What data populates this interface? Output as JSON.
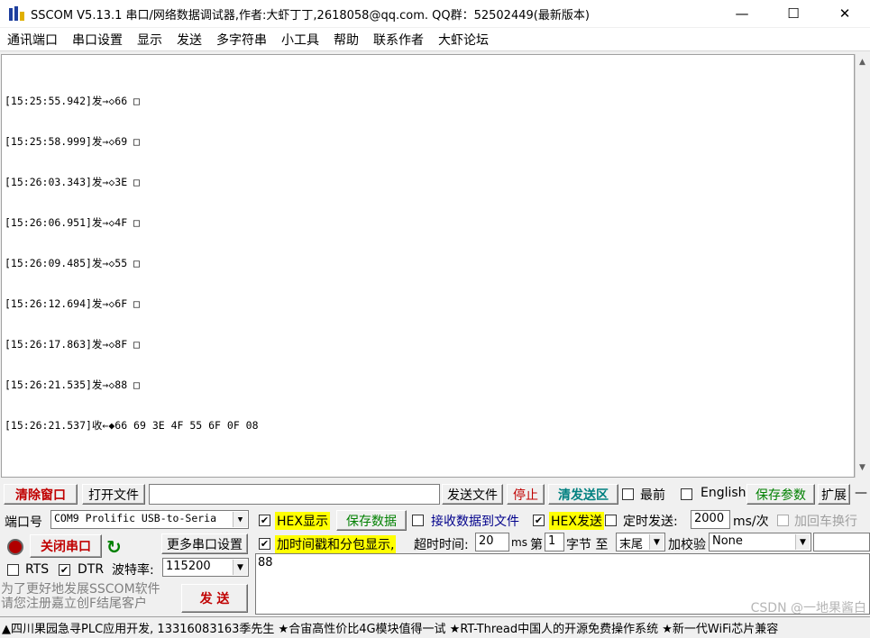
{
  "window": {
    "title": "SSCOM V5.13.1 串口/网络数据调试器,作者:大虾丁丁,2618058@qq.com. QQ群：52502449(最新版本)",
    "minimize": "—",
    "maximize": "☐",
    "close": "✕"
  },
  "menu": [
    "通讯端口",
    "串口设置",
    "显示",
    "发送",
    "多字符串",
    "小工具",
    "帮助",
    "联系作者",
    "大虾论坛"
  ],
  "log": [
    "[15:25:55.942]发→◇66 □",
    "[15:25:58.999]发→◇69 □",
    "[15:26:03.343]发→◇3E □",
    "[15:26:06.951]发→◇4F □",
    "[15:26:09.485]发→◇55 □",
    "[15:26:12.694]发→◇6F □",
    "[15:26:17.863]发→◇8F □",
    "[15:26:21.535]发→◇88 □",
    "[15:26:21.537]收←◆66 69 3E 4F 55 6F 0F 08"
  ],
  "toolbar": {
    "clear_window": "清除窗口",
    "open_file": "打开文件",
    "file_path": "",
    "send_file": "发送文件",
    "stop": "停止",
    "clear_send": "清发送区",
    "top_most": "最前",
    "english": "English",
    "save_params": "保存参数",
    "expand": "扩展",
    "dash": "—"
  },
  "port": {
    "label": "端口号",
    "value": "COM9 Prolific USB-to-Seria",
    "close_port": "关闭串口",
    "more_settings": "更多串口设置",
    "rts": "RTS",
    "dtr": "DTR",
    "baud_label": "波特率:",
    "baud_value": "115200"
  },
  "display": {
    "hex_display": "HEX显示",
    "save_data": "保存数据",
    "recv_to_file": "接收数据到文件",
    "add_timestamp": "加时间戳和分包显示,",
    "timeout_label": "超时时间:",
    "timeout_value": "20",
    "timeout_unit": "ms"
  },
  "send": {
    "hex_send": "HEX发送",
    "timed_send": "定时发送:",
    "interval_value": "2000",
    "interval_unit": "ms/次",
    "add_newline": "加回车换行",
    "byte_prefix": "第",
    "byte_from": "1",
    "byte_label": "字节 至",
    "byte_to": "末尾",
    "checksum_label": "加校验",
    "checksum_value": "None",
    "send_text": "88",
    "send_button": "发  送"
  },
  "promo": "为了更好地发展SSCOM软件\n请您注册嘉立创F结尾客户",
  "status_bar": "▲四川果园急寻PLC应用开发, 13316083163季先生 ★合宙高性价比4G模块值得一试 ★RT-Thread中国人的开源免费操作系统 ★新一代WiFi芯片兼容",
  "watermark": "CSDN @一地果酱白"
}
